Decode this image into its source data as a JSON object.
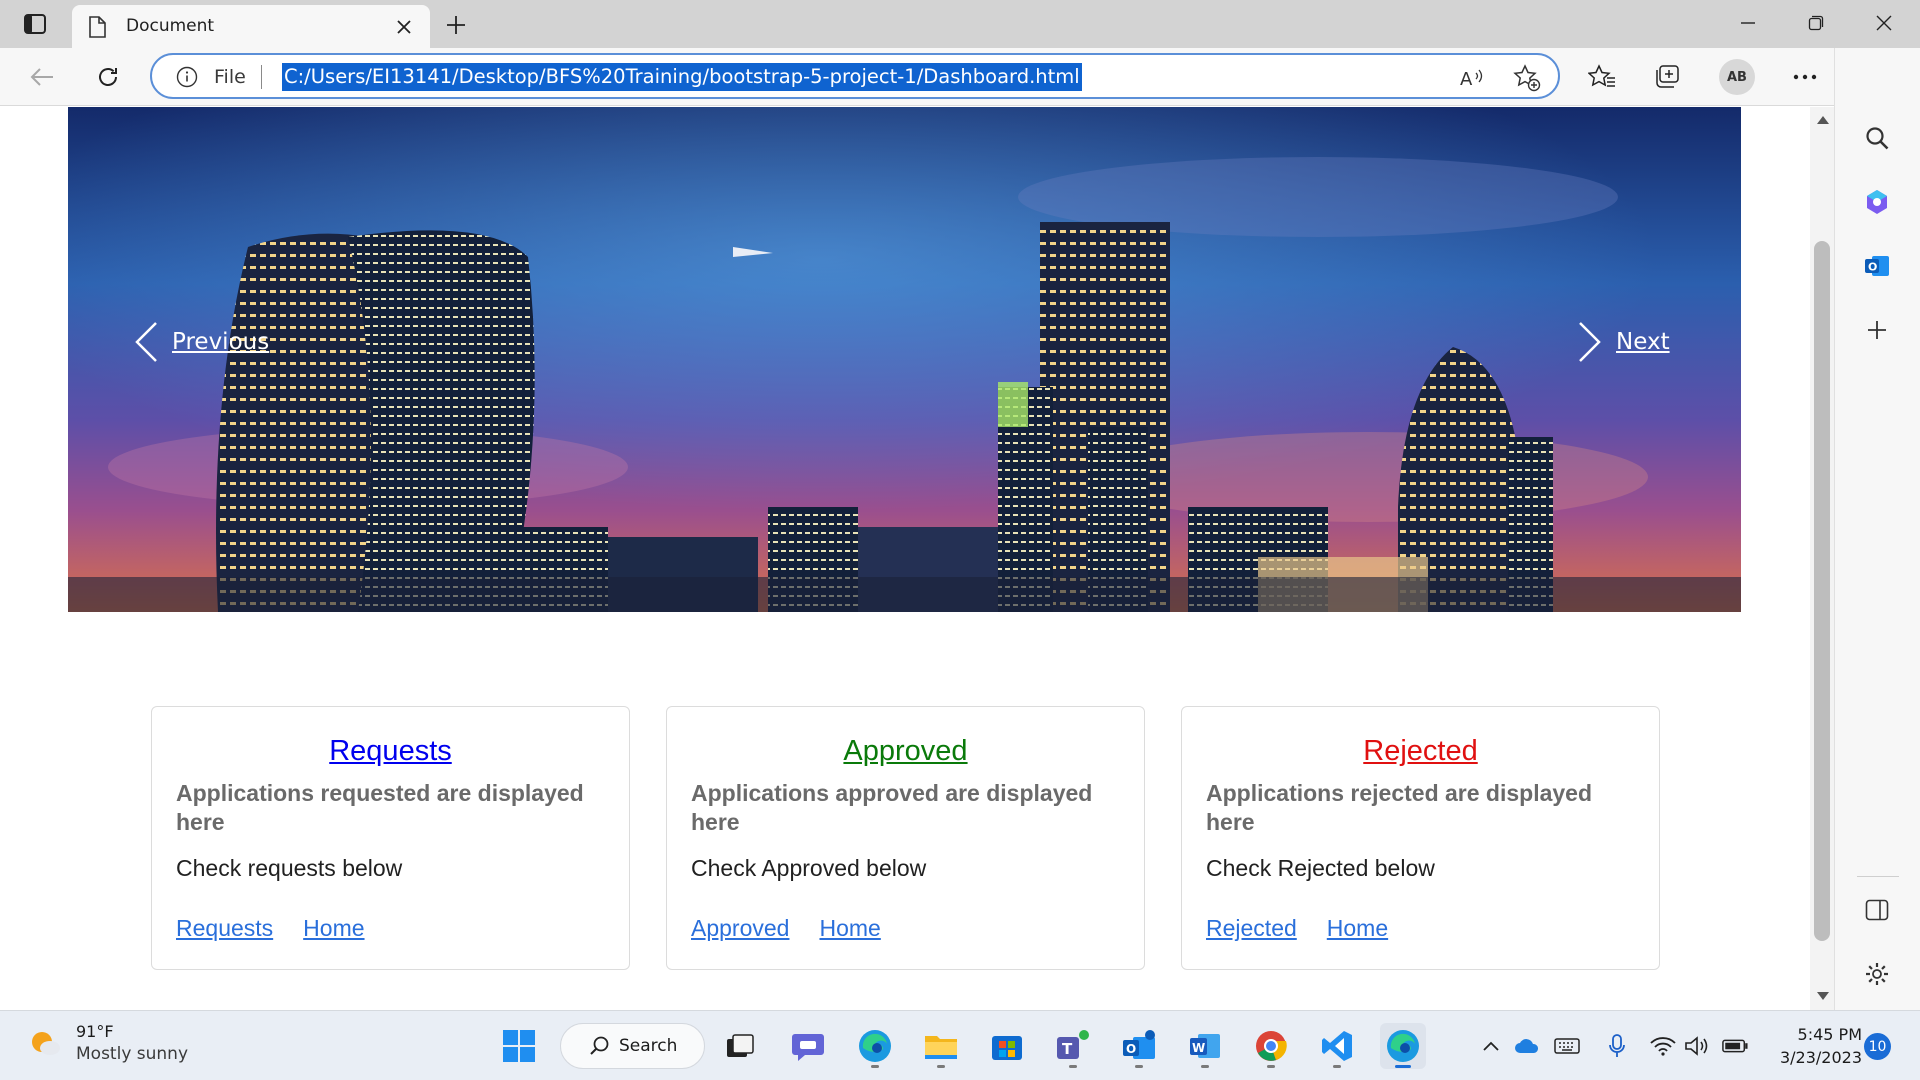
{
  "browser": {
    "tab_title": "Document",
    "address_scheme": "File",
    "url": "C:/Users/EI13141/Desktop/BFS%20Training/bootstrap-5-project-1/Dashboard.html",
    "profile_initials": "AB",
    "accent_color": "#0f63d0"
  },
  "carousel": {
    "prev_label": "Previous",
    "next_label": "Next"
  },
  "cards": [
    {
      "title": "Requests",
      "title_color": "#0000ee",
      "description": "Applications requested are displayed here",
      "subtitle": "Check requests below",
      "link_primary": "Requests",
      "link_home": "Home"
    },
    {
      "title": "Approved",
      "title_color": "#0a7a0a",
      "description": "Applications approved are displayed here",
      "subtitle": "Check Approved below",
      "link_primary": "Approved",
      "link_home": "Home"
    },
    {
      "title": "Rejected",
      "title_color": "#e01010",
      "description": "Applications rejected are displayed here",
      "subtitle": "Check Rejected below",
      "link_primary": "Rejected",
      "link_home": "Home"
    }
  ],
  "taskbar": {
    "weather_temp": "91°F",
    "weather_condition": "Mostly sunny",
    "search_label": "Search",
    "time": "5:45 PM",
    "date": "3/23/2023",
    "notification_count": "10"
  }
}
